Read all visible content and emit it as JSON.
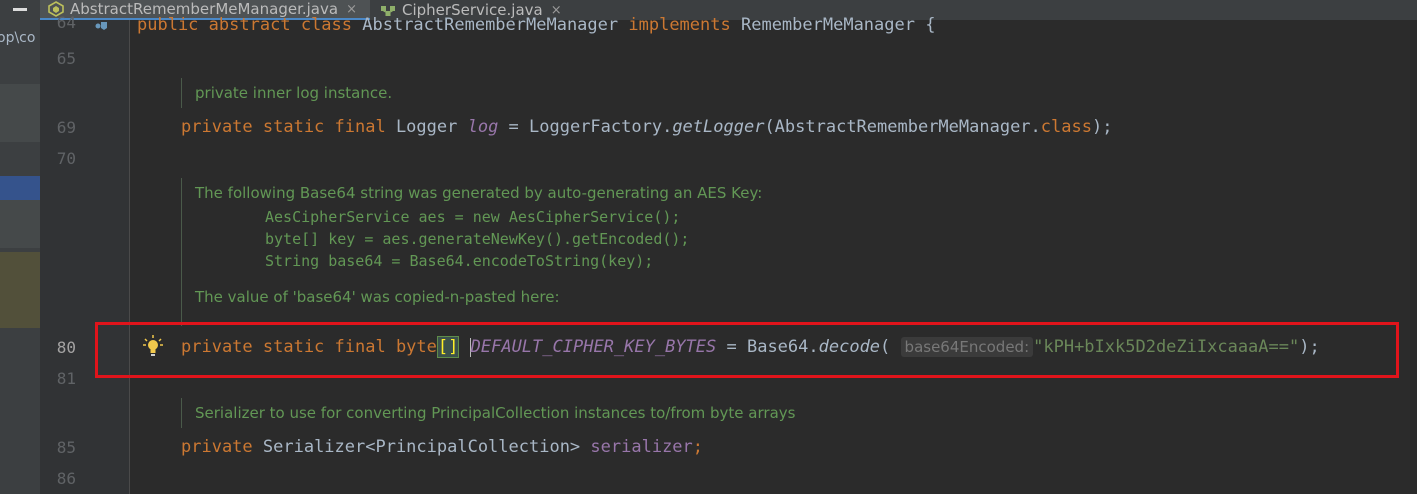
{
  "tabs": [
    {
      "label": "AbstractRememberMeManager.java",
      "active": true,
      "icon": "java-class-icon"
    },
    {
      "label": "CipherService.java",
      "active": false,
      "icon": "java-interface-icon"
    }
  ],
  "tab_close_glyph": "×",
  "sidebar_text": "op\\co",
  "line_numbers": {
    "l64": "64",
    "l65": "65",
    "l69": "69",
    "l70": "70",
    "l80": "80",
    "l81": "81",
    "l85": "85",
    "l86": "86"
  },
  "code": {
    "line64": "public abstract class AbstractRememberMeManager implements RememberMeManager {",
    "log_decl": {
      "kw": "private static final",
      "type": " Logger ",
      "name": "log",
      "eq": " = LoggerFactory.",
      "method": "getLogger",
      "args": "(AbstractRememberMeManager.",
      "kw_class": "class",
      "end": ");"
    },
    "key_decl": {
      "kw": "private static final",
      "type": " byte",
      "brackets": "[]",
      "name": "DEFAULT_CIPHER_KEY_BYTES",
      "eq": " = Base64.",
      "method": "decode",
      "open": "(",
      "hint": "base64Encoded:",
      "value": "\"kPH+bIxk5D2deZiIxcaaaA==\"",
      "end": ");"
    },
    "serializer_decl": {
      "kw": "private",
      "type": " Serializer<PrincipalCollection> ",
      "name": "serializer",
      "end": ";"
    }
  },
  "docs": {
    "log_doc": "private inner log instance.",
    "aes_doc_intro": "The following Base64 string was generated by auto-generating an AES Key:",
    "aes_code_1": "AesCipherService aes = new AesCipherService();",
    "aes_code_2": "byte[] key = aes.generateNewKey().getEncoded();",
    "aes_code_3": "String base64 = Base64.encodeToString(key);",
    "aes_doc_outro": "The value of 'base64' was copied-n-pasted here:",
    "serializer_doc": "Serializer to use for converting PrincipalCollection instances to/from byte arrays"
  },
  "colors": {
    "highlight_box": "#e0141b",
    "keyword": "#cc7832",
    "string": "#6a8759",
    "field": "#9876aa",
    "doc": "#629755"
  }
}
